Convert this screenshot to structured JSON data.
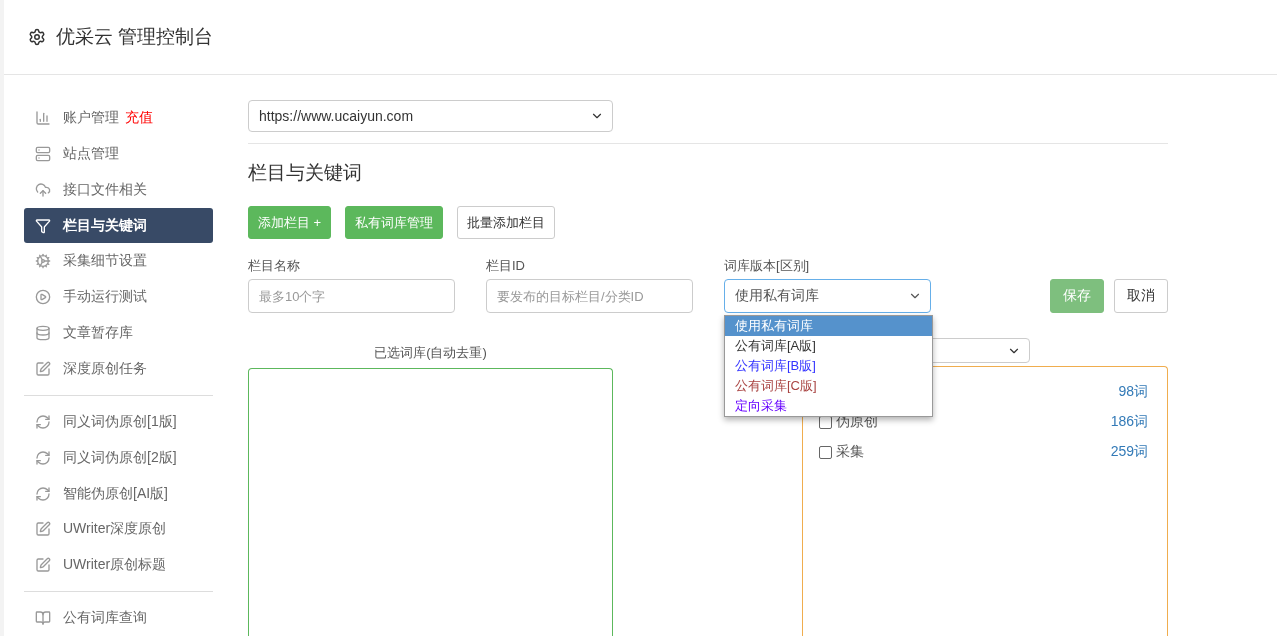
{
  "header": {
    "title": "优采云 管理控制台"
  },
  "sidebar": {
    "groups": [
      {
        "items": [
          {
            "label": "账户管理",
            "tag": "充值",
            "selected": false
          },
          {
            "label": "站点管理",
            "selected": false
          },
          {
            "label": "接口文件相关",
            "selected": false
          },
          {
            "label": "栏目与关键词",
            "selected": true
          },
          {
            "label": "采集细节设置",
            "selected": false
          },
          {
            "label": "手动运行测试",
            "selected": false
          },
          {
            "label": "文章暂存库",
            "selected": false
          },
          {
            "label": "深度原创任务",
            "selected": false
          }
        ]
      },
      {
        "items": [
          {
            "label": "同义词伪原创[1版]",
            "selected": false
          },
          {
            "label": "同义词伪原创[2版]",
            "selected": false
          },
          {
            "label": "智能伪原创[AI版]",
            "selected": false
          },
          {
            "label": "UWriter深度原创",
            "selected": false
          },
          {
            "label": "UWriter原创标题",
            "selected": false
          }
        ]
      },
      {
        "items": [
          {
            "label": "公有词库查询",
            "selected": false
          }
        ]
      }
    ]
  },
  "site_select": {
    "value": "https://www.ucaiyun.com"
  },
  "section_title": "栏目与关键词",
  "actions": [
    {
      "label": "添加栏目 +",
      "kind": "primary"
    },
    {
      "label": "私有词库管理",
      "kind": "primary"
    },
    {
      "label": "批量添加栏目",
      "kind": "default"
    }
  ],
  "form": {
    "fields": [
      {
        "label": "栏目名称",
        "placeholder": "最多10个字",
        "kind": "input"
      },
      {
        "label": "栏目ID",
        "placeholder": "要发布的目标栏目/分类ID",
        "kind": "input"
      },
      {
        "label": "词库版本[区别]",
        "value": "使用私有词库",
        "kind": "select",
        "expanded": true,
        "options": [
          {
            "label": "使用私有词库",
            "selected": true
          },
          {
            "label": "公有词库[A版]",
            "selected": false,
            "color": "#333333"
          },
          {
            "label": "公有词库[B版]",
            "selected": false,
            "color": "#3333ff"
          },
          {
            "label": "公有词库[C版]",
            "selected": false,
            "color": "#a94442"
          },
          {
            "label": "定向采集",
            "selected": false,
            "color": "#6600ff"
          }
        ]
      }
    ],
    "buttons": [
      {
        "label": "保存",
        "kind": "primary"
      },
      {
        "label": "取消",
        "kind": "default"
      }
    ]
  },
  "selected_panel": {
    "title": "已选词库(自动去重)"
  },
  "library_list": [
    {
      "count": "98词"
    },
    {
      "label": "伪原创",
      "count": "186词",
      "checked": false
    },
    {
      "label": "采集",
      "count": "259词",
      "checked": false
    }
  ]
}
